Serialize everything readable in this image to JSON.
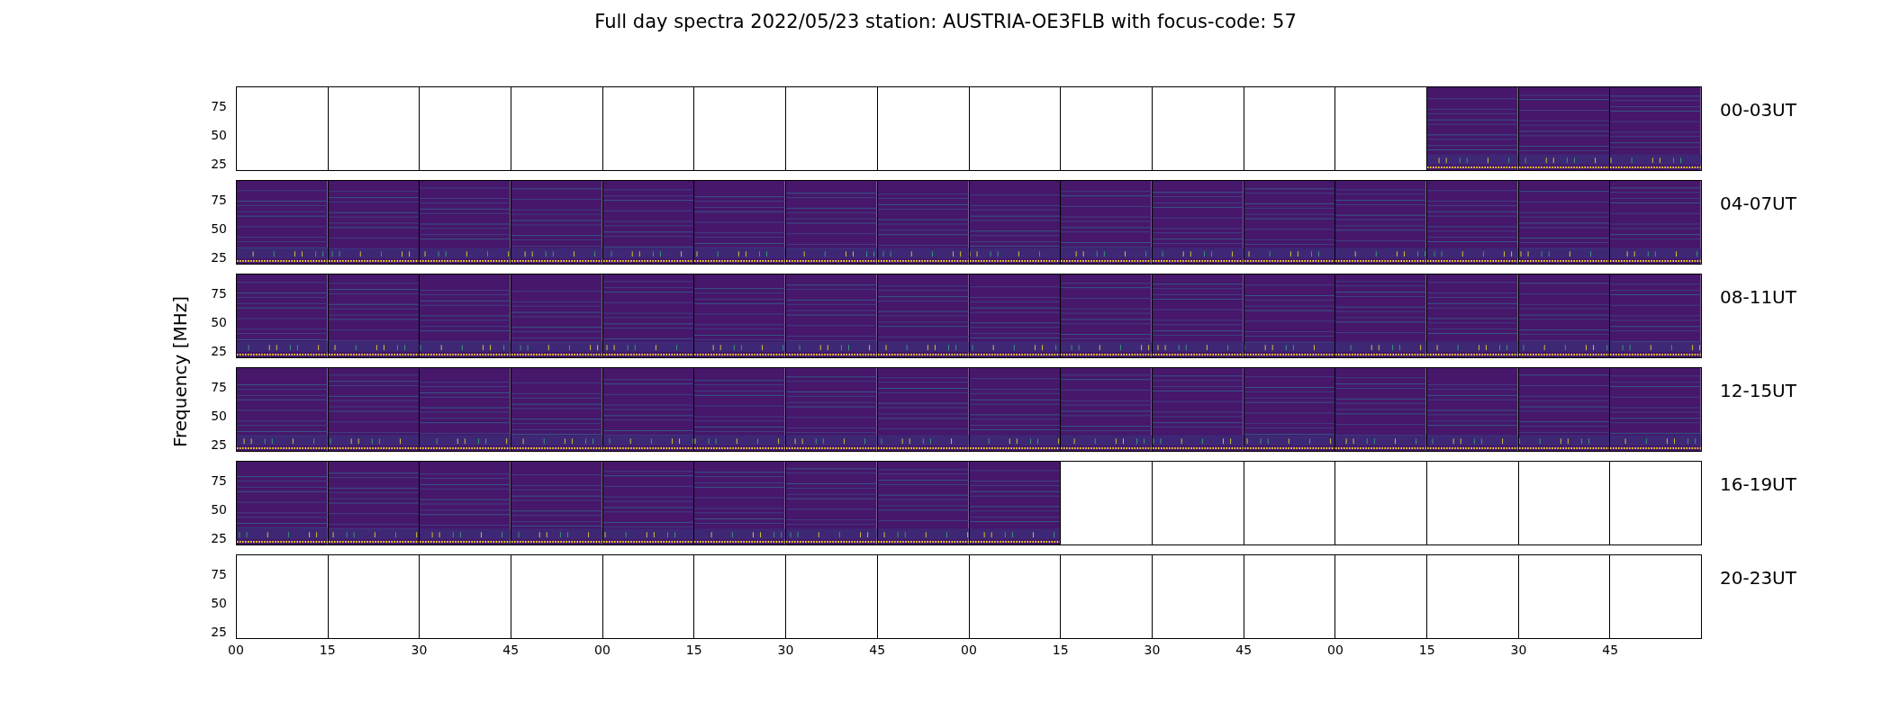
{
  "title": "Full day spectra 2022/05/23 station: AUSTRIA-OE3FLB with focus-code: 57",
  "ylabel": "Frequency [MHz]",
  "xticks": [
    "00",
    "15",
    "30",
    "45",
    "00",
    "15",
    "30",
    "45",
    "00",
    "15",
    "30",
    "45",
    "00",
    "15",
    "30",
    "45"
  ],
  "rows": [
    {
      "label": "00-03UT",
      "yticks": [
        "75",
        "50",
        "25"
      ],
      "panels": [
        {
          "filled": false
        },
        {
          "filled": false
        },
        {
          "filled": false
        },
        {
          "filled": false
        },
        {
          "filled": false
        },
        {
          "filled": false
        },
        {
          "filled": false
        },
        {
          "filled": false
        },
        {
          "filled": false
        },
        {
          "filled": false
        },
        {
          "filled": false
        },
        {
          "filled": false
        },
        {
          "filled": false
        },
        {
          "filled": true
        },
        {
          "filled": true
        },
        {
          "filled": true
        }
      ]
    },
    {
      "label": "04-07UT",
      "yticks": [
        "75",
        "50",
        "25"
      ],
      "panels": [
        {
          "filled": true
        },
        {
          "filled": true
        },
        {
          "filled": true
        },
        {
          "filled": true
        },
        {
          "filled": true
        },
        {
          "filled": true
        },
        {
          "filled": true
        },
        {
          "filled": true
        },
        {
          "filled": true
        },
        {
          "filled": true
        },
        {
          "filled": true
        },
        {
          "filled": true
        },
        {
          "filled": true
        },
        {
          "filled": true
        },
        {
          "filled": true
        },
        {
          "filled": true
        }
      ]
    },
    {
      "label": "08-11UT",
      "yticks": [
        "75",
        "50",
        "25"
      ],
      "panels": [
        {
          "filled": true
        },
        {
          "filled": true
        },
        {
          "filled": true
        },
        {
          "filled": true
        },
        {
          "filled": true
        },
        {
          "filled": true
        },
        {
          "filled": true
        },
        {
          "filled": true
        },
        {
          "filled": true
        },
        {
          "filled": true
        },
        {
          "filled": true
        },
        {
          "filled": true
        },
        {
          "filled": true
        },
        {
          "filled": true
        },
        {
          "filled": true
        },
        {
          "filled": true
        }
      ]
    },
    {
      "label": "12-15UT",
      "yticks": [
        "75",
        "50",
        "25"
      ],
      "panels": [
        {
          "filled": true
        },
        {
          "filled": true
        },
        {
          "filled": true
        },
        {
          "filled": true
        },
        {
          "filled": true
        },
        {
          "filled": true
        },
        {
          "filled": true
        },
        {
          "filled": true
        },
        {
          "filled": true
        },
        {
          "filled": true
        },
        {
          "filled": true
        },
        {
          "filled": true
        },
        {
          "filled": true
        },
        {
          "filled": true
        },
        {
          "filled": true
        },
        {
          "filled": true
        }
      ]
    },
    {
      "label": "16-19UT",
      "yticks": [
        "75",
        "50",
        "25"
      ],
      "panels": [
        {
          "filled": true
        },
        {
          "filled": true
        },
        {
          "filled": true
        },
        {
          "filled": true
        },
        {
          "filled": true
        },
        {
          "filled": true
        },
        {
          "filled": true
        },
        {
          "filled": true
        },
        {
          "filled": true
        },
        {
          "filled": false
        },
        {
          "filled": false
        },
        {
          "filled": false
        },
        {
          "filled": false
        },
        {
          "filled": false
        },
        {
          "filled": false
        },
        {
          "filled": false
        }
      ]
    },
    {
      "label": "20-23UT",
      "yticks": [
        "75",
        "50",
        "25"
      ],
      "panels": [
        {
          "filled": false
        },
        {
          "filled": false
        },
        {
          "filled": false
        },
        {
          "filled": false
        },
        {
          "filled": false
        },
        {
          "filled": false
        },
        {
          "filled": false
        },
        {
          "filled": false
        },
        {
          "filled": false
        },
        {
          "filled": false
        },
        {
          "filled": false
        },
        {
          "filled": false
        },
        {
          "filled": false
        },
        {
          "filled": false
        },
        {
          "filled": false
        },
        {
          "filled": false
        }
      ]
    }
  ]
}
